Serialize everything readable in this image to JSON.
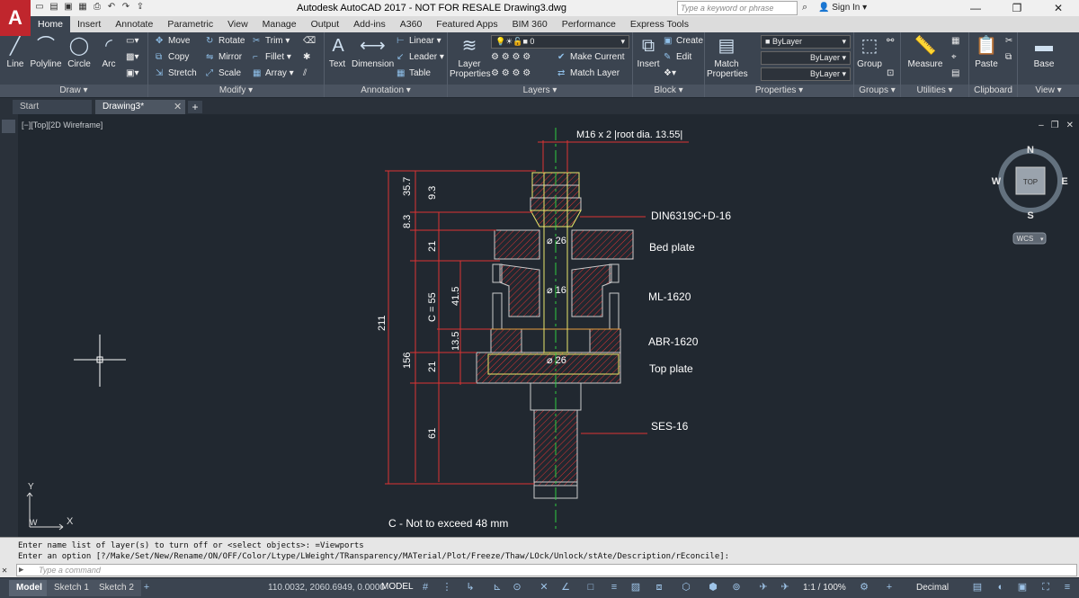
{
  "app": {
    "title": "Autodesk AutoCAD 2017 - NOT FOR RESALE    Drawing3.dwg",
    "logo": "A",
    "search_placeholder": "Type a keyword or phrase",
    "signin": "Sign In"
  },
  "ribbon_tabs": [
    "Home",
    "Insert",
    "Annotate",
    "Parametric",
    "View",
    "Manage",
    "Output",
    "Add-ins",
    "A360",
    "Featured Apps",
    "BIM 360",
    "Performance",
    "Express Tools"
  ],
  "ribbon": {
    "draw": {
      "label": "Draw ▾",
      "line": "Line",
      "polyline": "Polyline",
      "circle": "Circle",
      "arc": "Arc"
    },
    "modify": {
      "label": "Modify ▾",
      "move": "Move",
      "rotate": "Rotate",
      "trim": "Trim ▾",
      "copy": "Copy",
      "mirror": "Mirror",
      "fillet": "Fillet ▾",
      "stretch": "Stretch",
      "scale": "Scale",
      "array": "Array ▾"
    },
    "annotation": {
      "label": "Annotation ▾",
      "text": "Text",
      "dimension": "Dimension",
      "linear": "Linear ▾",
      "leader": "Leader ▾",
      "table": "Table"
    },
    "layers": {
      "label": "Layers ▾",
      "layer_properties": "Layer Properties",
      "current_layer": "0",
      "make_current": "Make Current",
      "match_layer": "Match Layer"
    },
    "block": {
      "label": "Block ▾",
      "insert": "Insert",
      "create": "Create",
      "edit": "Edit"
    },
    "properties": {
      "label": "Properties ▾",
      "match_properties": "Match Properties",
      "color": "ByLayer",
      "linetype": "ByLayer",
      "lineweight": "ByLayer"
    },
    "groups": {
      "label": "Groups ▾",
      "group": "Group"
    },
    "utilities": {
      "label": "Utilities ▾",
      "measure": "Measure"
    },
    "clipboard": {
      "label": "Clipboard",
      "paste": "Paste"
    },
    "view": {
      "label": "View ▾",
      "base": "Base"
    }
  },
  "file_tabs": {
    "start": "Start",
    "drawing": "Drawing3*"
  },
  "viewport_label": "[−][Top][2D Wireframe]",
  "viewcube": {
    "n": "N",
    "s": "S",
    "e": "E",
    "w": "W",
    "top": "TOP",
    "wcs": "WCS"
  },
  "ucs": {
    "y": "Y",
    "x": "X",
    "w": "W"
  },
  "drawing": {
    "thread_callout": "M16 x 2 |root dia. 13.55|",
    "labels": {
      "din": "DIN6319C+D-16",
      "bed": "Bed plate",
      "ml": "ML-1620",
      "abr": "ABR-1620",
      "top": "Top plate",
      "ses": "SES-16"
    },
    "dims": {
      "d1": "⌀ 26",
      "d2": "⌀ 16",
      "d3": "⌀ 26",
      "v357": "35.7",
      "v93": "9.3",
      "v83": "8.3",
      "v21a": "21",
      "vc55": "C = 55",
      "v415": "41.5",
      "v135": "13.5",
      "v156": "156",
      "v21b": "21",
      "v61": "61",
      "v211": "211"
    },
    "note": "C - Not to exceed 48 mm"
  },
  "command": {
    "history1": "Enter name list of layer(s) to turn off or <select objects>: =Viewports",
    "history2": "Enter an option [?/Make/Set/New/Rename/ON/OFF/Color/Ltype/LWeight/TRansparency/MATerial/Plot/Freeze/Thaw/LOck/Unlock/stAte/Description/rEconcile]:",
    "prompt_glyph": "▶",
    "placeholder": "Type a command"
  },
  "status": {
    "tabs": [
      "Model",
      "Sketch 1",
      "Sketch 2"
    ],
    "coords": "110.0032, 2060.6949, 0.0000",
    "model": "MODEL",
    "scale": "1:1 / 100%",
    "units": "Decimal"
  }
}
